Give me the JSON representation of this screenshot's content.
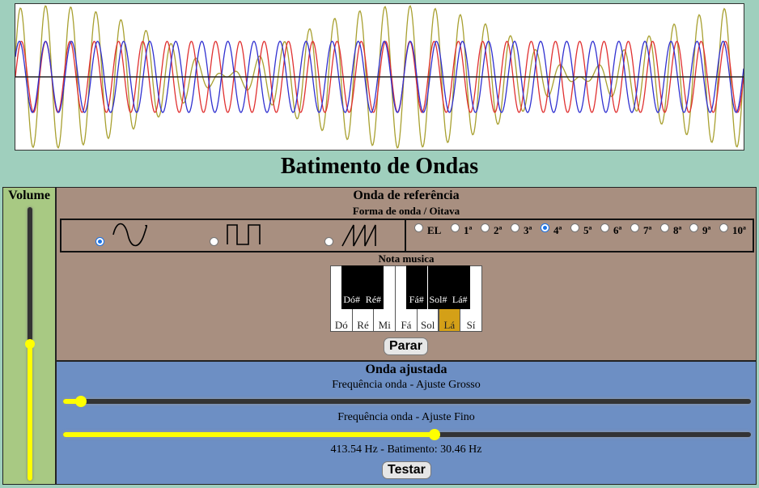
{
  "title": "Batimento de Ondas",
  "volume": {
    "label": "Volume",
    "level": 0.5
  },
  "reference": {
    "title": "Onda de referência",
    "subtitle": "Forma de onda / Oitava",
    "waveforms": [
      {
        "icon": "sine-wave-icon",
        "checked": true
      },
      {
        "icon": "square-wave-icon",
        "checked": false
      },
      {
        "icon": "sawtooth-wave-icon",
        "checked": false
      }
    ],
    "octaves": [
      {
        "label": "EL",
        "checked": false
      },
      {
        "label": "1ª",
        "checked": false
      },
      {
        "label": "2ª",
        "checked": false
      },
      {
        "label": "3ª",
        "checked": false
      },
      {
        "label": "4ª",
        "checked": true
      },
      {
        "label": "5ª",
        "checked": false
      },
      {
        "label": "6ª",
        "checked": false
      },
      {
        "label": "7ª",
        "checked": false
      },
      {
        "label": "8ª",
        "checked": false
      },
      {
        "label": "9ª",
        "checked": false
      },
      {
        "label": "10ª",
        "checked": false
      }
    ],
    "note_label": "Nota musica",
    "white_keys": [
      "Dó",
      "Ré",
      "Mi",
      "Fá",
      "Sol",
      "Lá",
      "Sí"
    ],
    "black_keys": [
      "Dó#",
      "Ré#",
      "Fá#",
      "Sol#",
      "Lá#"
    ],
    "active_note": "Lá",
    "stop_button": "Parar"
  },
  "adjusted": {
    "title": "Onda ajustada",
    "coarse_label": "Frequência onda - Ajuste Grosso",
    "coarse_value": 0.026,
    "fine_label": "Frequência onda - Ajuste Fino",
    "fine_value": 0.54,
    "readout": "413.54 Hz - Batimento: 30.46 Hz",
    "test_button": "Testar"
  },
  "colors": {
    "reference_wave": "#e03030",
    "adjusted_wave": "#3030d0",
    "sum_wave": "#a8a030",
    "axis": "#222222"
  },
  "chart_data": {
    "type": "line",
    "series": [
      {
        "role": "reference",
        "frequency_hz": 444
      },
      {
        "role": "adjusted",
        "frequency_hz": 413.54
      },
      {
        "role": "sum"
      }
    ],
    "beat_hz": 30.46
  }
}
